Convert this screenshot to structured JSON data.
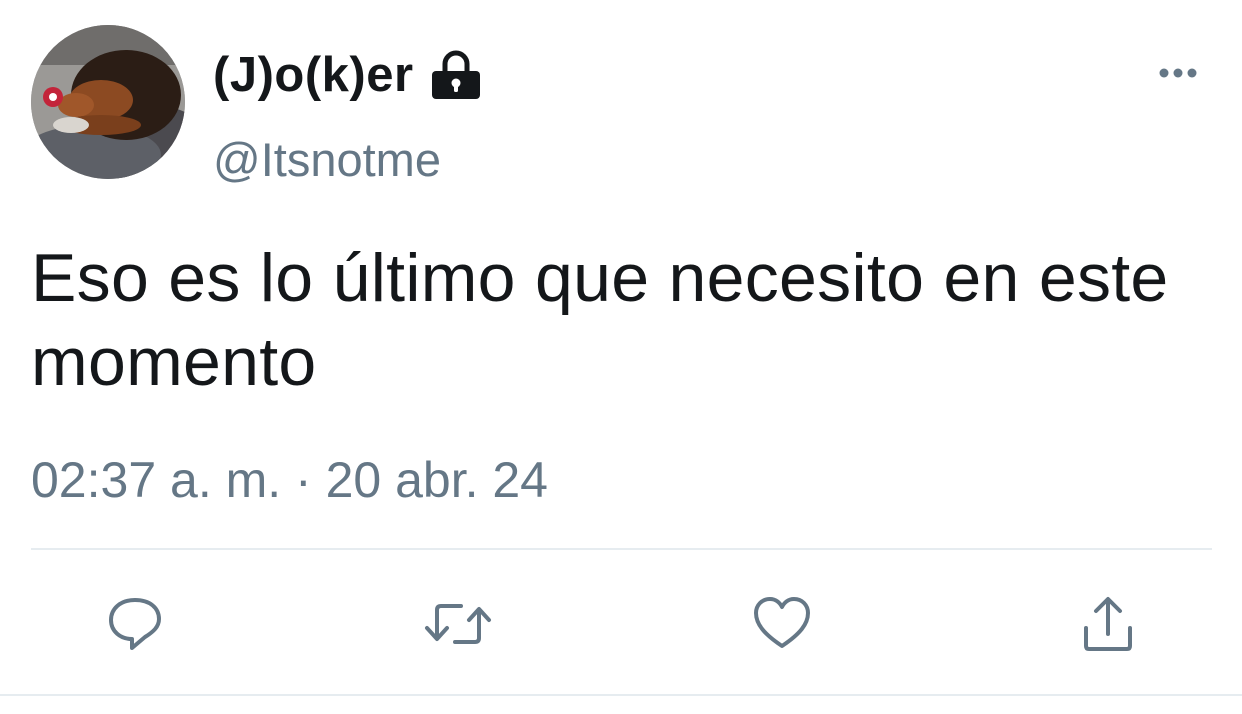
{
  "tweet": {
    "author": {
      "display_name": "(J)o(k)er",
      "handle": "@Itsnotme",
      "protected_icon": "lock-icon",
      "avatar": "puppy-avatar"
    },
    "text": "Eso es lo último que necesito en este momento",
    "timestamp": "02:37 a. m. · 20 abr. 24",
    "menu_icon": "more-horizontal-icon",
    "actions": [
      {
        "name": "reply",
        "icon": "reply-icon"
      },
      {
        "name": "retweet",
        "icon": "retweet-icon"
      },
      {
        "name": "like",
        "icon": "heart-icon"
      },
      {
        "name": "share",
        "icon": "share-icon"
      }
    ]
  },
  "colors": {
    "text_primary": "#14171a",
    "text_secondary": "#657786",
    "divider": "#e6ecf0"
  }
}
